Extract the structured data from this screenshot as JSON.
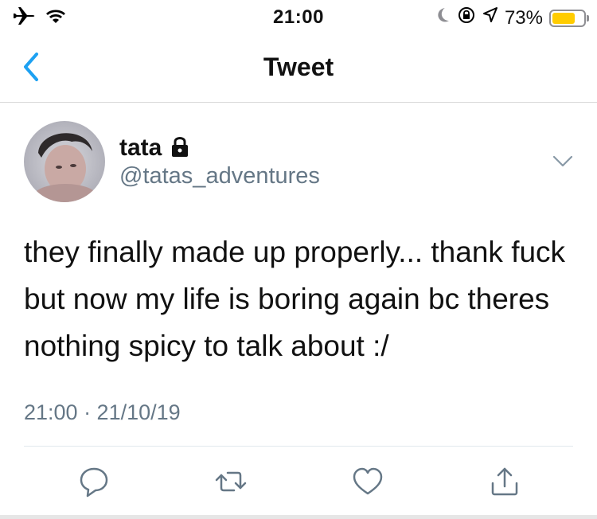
{
  "status_bar": {
    "time": "21:00",
    "battery_level": 0.73,
    "battery_text": "73%",
    "icons": [
      "airplane-icon",
      "wifi-icon",
      "moon-icon",
      "rotation-lock-icon",
      "location-icon",
      "battery-icon"
    ]
  },
  "nav": {
    "title": "Tweet",
    "back_icon": "chevron-left-icon"
  },
  "tweet": {
    "author_name": "tata",
    "protected_icon": "lock-icon",
    "handle": "@tatas_adventures",
    "text": "they finally made up properly... thank fuck but now my life is boring again bc theres nothing spicy to talk about :/",
    "timestamp": "21:00 · 21/10/19",
    "menu_icon": "chevron-down-icon"
  },
  "actions": [
    {
      "name": "reply",
      "icon": "reply-icon"
    },
    {
      "name": "retweet",
      "icon": "retweet-icon"
    },
    {
      "name": "like",
      "icon": "heart-icon"
    },
    {
      "name": "share",
      "icon": "share-icon"
    }
  ],
  "colors": {
    "accent": "#1da1f2",
    "secondary_text": "#657786",
    "battery": "#ffcc00"
  }
}
